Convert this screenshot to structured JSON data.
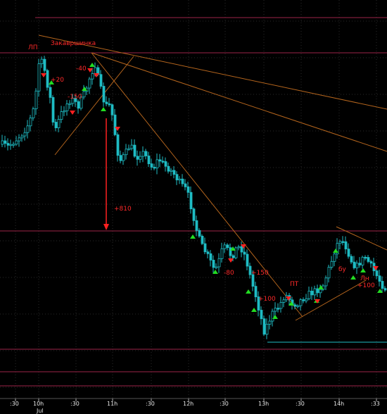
{
  "chart_data": {
    "type": "candlestick",
    "x_ticks": [
      ":30",
      "10h",
      ":30",
      "11h",
      ":30",
      "12h",
      ":30",
      "13h",
      ":30",
      "14h",
      ":33"
    ],
    "x_sub_label": "Jul",
    "annotations": [
      "ЛП",
      "Закавршинка",
      "+20",
      "-40",
      "-150",
      "+810",
      "-80",
      "+150",
      "+100",
      "ПТ",
      "бу",
      "Лн",
      "+100"
    ],
    "colors": {
      "background": "#000000",
      "candle": "#1fbcc4",
      "grid": "#2a2a2a",
      "level_line": "#9c2448",
      "trend_line": "#b5651d",
      "signal_up": "#22dd22",
      "signal_down": "#ff2020",
      "label": "#ff2a2a",
      "axis_text": "#e8e8e8"
    },
    "grid": true,
    "signals": {
      "up_count": 17,
      "down_count": 10
    }
  }
}
